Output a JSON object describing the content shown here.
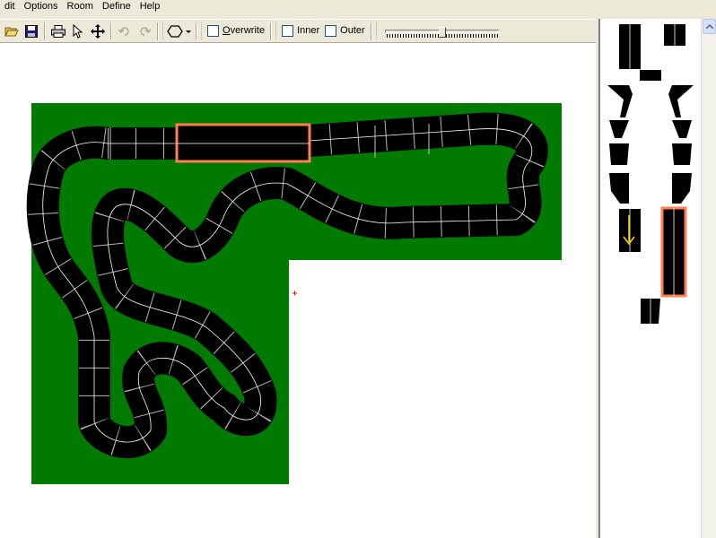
{
  "menu": {
    "items": [
      {
        "label": "dit"
      },
      {
        "label": "Options"
      },
      {
        "label": "Room"
      },
      {
        "label": "Define"
      },
      {
        "label": "Help"
      }
    ]
  },
  "toolbar": {
    "icons": {
      "open": "open-folder-icon",
      "save": "save-disk-icon",
      "print": "printer-icon",
      "select": "arrow-pointer-icon",
      "move": "move-cross-icon",
      "undo": "undo-icon",
      "redo": "redo-icon",
      "shape": "hexagon-dropdown-icon"
    },
    "overwrite_label": "Overwrite",
    "overwrite_checked": false,
    "inner_label": "Inner",
    "inner_checked": false,
    "outer_label": "Outer",
    "outer_checked": false,
    "slider_value_fraction": 0.5
  },
  "colors": {
    "background": "#ece9d8",
    "board": "#007a00",
    "track": "#000000",
    "track_lines": "#ffffff",
    "highlight": "#ff7f50",
    "arrow": "#ffd700",
    "grid_dot": "#000000",
    "cursor_marker": "#ff0000"
  }
}
